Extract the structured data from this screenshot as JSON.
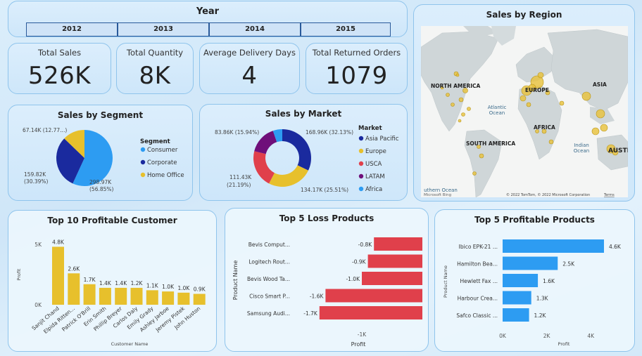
{
  "slicer": {
    "title": "Year",
    "years": [
      "2012",
      "2013",
      "2014",
      "2015"
    ]
  },
  "kpis": [
    {
      "title": "Total Sales",
      "value": "526K"
    },
    {
      "title": "Total Quantity",
      "value": "8K"
    },
    {
      "title": "Average Delivery Days",
      "value": "4"
    },
    {
      "title": "Total Returned Orders",
      "value": "1079"
    }
  ],
  "map": {
    "title": "Sales by Region",
    "labels": {
      "north_america": "NORTH AMERICA",
      "europe": "EUROPE",
      "asia": "ASIA",
      "atlantic": "Atlantic",
      "ocean1": "Ocean",
      "africa": "AFRICA",
      "south_america": "SOUTH AMERICA",
      "indian": "Indian",
      "ocean2": "Ocean",
      "austra": "AUSTRA",
      "southern": "uthern Ocean",
      "bing": "Microsoft Bing",
      "copyright": "© 2022 TomTom, © 2022 Microsoft Corporation",
      "terms": "Terms"
    },
    "bubble_color": "#e8c23a"
  },
  "chart_data": [
    {
      "type": "pie",
      "title": "Sales by Segment",
      "legend_title": "Segment",
      "categories": [
        "Consumer",
        "Corporate",
        "Home Office"
      ],
      "values": [
        298.97,
        159.82,
        67.14
      ],
      "value_labels": [
        "298.97K (56.85%)",
        "159.82K (30.39%)",
        "67.14K (12.77...)"
      ],
      "colors": [
        "#2d9cf2",
        "#1a2a9e",
        "#e7c02c"
      ],
      "legend_position": "right"
    },
    {
      "type": "pie",
      "title": "Sales by Market",
      "legend_title": "Market",
      "donut": true,
      "categories": [
        "Asia Pacific",
        "Europe",
        "USCA",
        "LATAM",
        "Africa"
      ],
      "values": [
        168.96,
        134.17,
        111.43,
        83.86,
        27.5
      ],
      "value_labels": [
        "168.96K (32.13%)",
        "134.17K (25.51%)",
        "111.43K (21.19%)",
        "83.86K (15.94%)",
        ""
      ],
      "colors": [
        "#1a2a9e",
        "#e7c02c",
        "#e0404b",
        "#6f0f7a",
        "#2d9cf2"
      ],
      "legend_position": "right"
    },
    {
      "type": "bar",
      "title": "Top 10 Profitable Customer",
      "xlabel": "Customer Name",
      "ylabel": "Profit",
      "categories": [
        "Sanjit Chand",
        "Elpida Ritten...",
        "Patrick O'Brill",
        "Erin Smith",
        "Phillip Breyer",
        "Carlos Daly",
        "Emily Grady",
        "Ashley Jarboe",
        "Jeremy Pistek",
        "John Huston"
      ],
      "values": [
        4.8,
        2.6,
        1.7,
        1.4,
        1.4,
        1.4,
        1.2,
        1.1,
        1.0,
        0.9
      ],
      "value_labels": [
        "4.8K",
        "2.6K",
        "1.7K",
        "1.4K",
        "1.4K",
        "1.2K",
        "1.1K",
        "1.0K",
        "1.0K",
        "0.9K"
      ],
      "yticks": [
        "5K",
        "0K"
      ],
      "ylim": [
        0,
        5
      ],
      "color": "#e7c02c"
    },
    {
      "type": "bar",
      "orientation": "horizontal",
      "title": "Top 5 Loss Products",
      "xlabel": "Profit",
      "ylabel": "Product Name",
      "categories": [
        "Bevis Comput...",
        "Logitech Rout...",
        "Bevis Wood Ta...",
        "Cisco Smart P...",
        "Samsung Audi..."
      ],
      "values": [
        -0.8,
        -0.9,
        -1.0,
        -1.6,
        -1.7
      ],
      "value_labels": [
        "-0.8K",
        "-0.9K",
        "-1.0K",
        "-1.6K",
        "-1.7K"
      ],
      "xticks": [
        "-1K"
      ],
      "color": "#e0404b"
    },
    {
      "type": "bar",
      "orientation": "horizontal",
      "title": "Top 5 Profitable Products",
      "xlabel": "Profit",
      "ylabel": "Product Name",
      "categories": [
        "Ibico EPK-21 ...",
        "Hamilton Bea...",
        "Hewlett Fax ...",
        "Harbour Crea...",
        "Safco Classic ..."
      ],
      "values": [
        4.6,
        2.5,
        1.6,
        1.3,
        1.2
      ],
      "value_labels": [
        "4.6K",
        "2.5K",
        "1.6K",
        "1.3K",
        "1.2K"
      ],
      "xticks": [
        "0K",
        "2K",
        "4K"
      ],
      "xlim": [
        0,
        5
      ],
      "color": "#2d9cf2"
    }
  ]
}
